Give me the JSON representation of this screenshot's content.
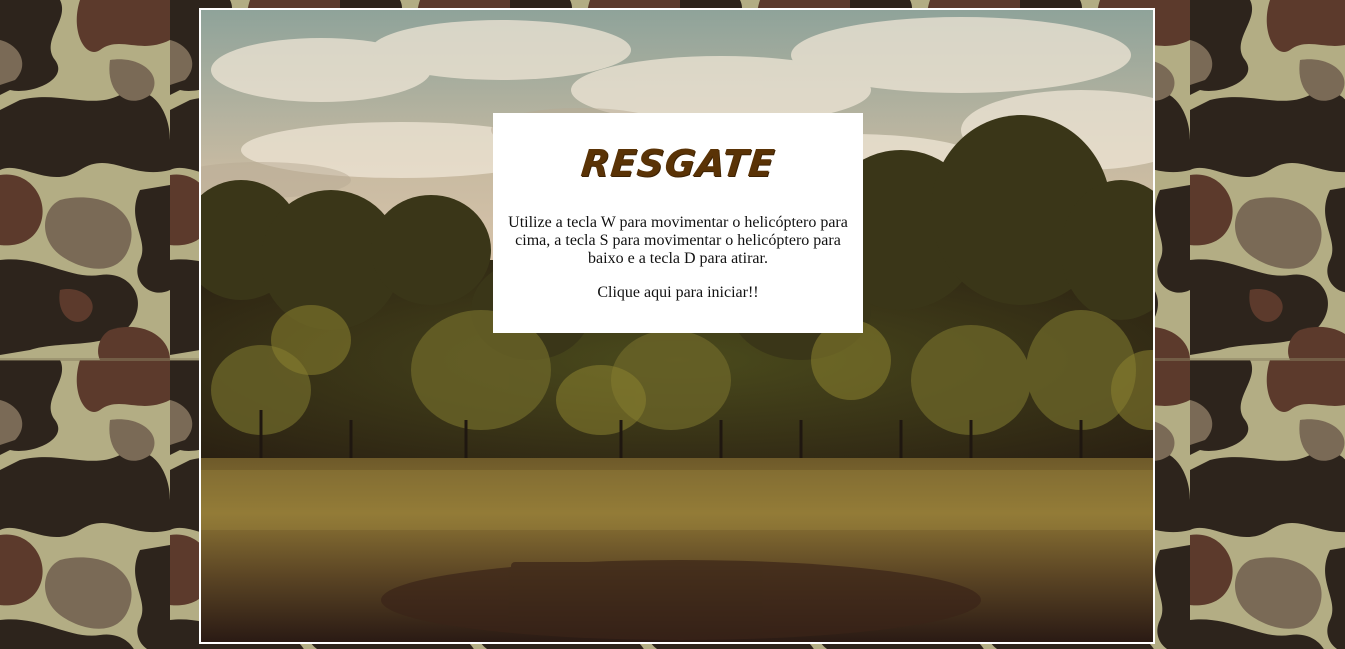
{
  "game": {
    "title": "RESGATE",
    "instructions": "Utilize a tecla W para movimentar o helicóptero para cima, a tecla S para movimentar o helicóptero para baixo e a tecla D para atirar.",
    "start_prompt": "Clique aqui para iniciar!!"
  },
  "colors": {
    "title": "#5a3306",
    "panel_background": "#ffffff",
    "frame_border": "#ffffff",
    "camo_light": "#b3ad84",
    "camo_mid": "#7a6a56",
    "camo_brown": "#5c3a2c",
    "camo_dark": "#2d241c"
  }
}
